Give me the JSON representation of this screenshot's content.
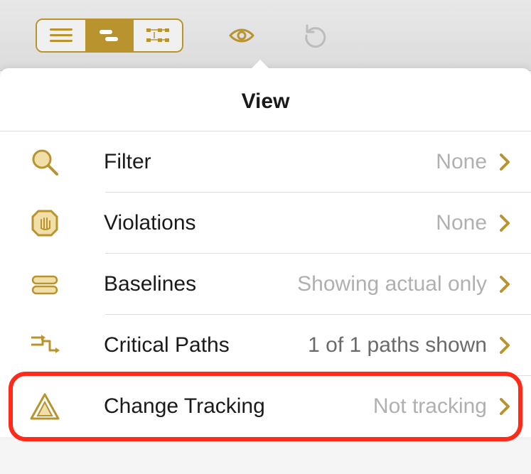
{
  "toolbar": {
    "segments": [
      "list-view",
      "gantt-view",
      "network-view"
    ],
    "active_segment": 1,
    "eye_label": "view-options",
    "undo_label": "undo"
  },
  "popover": {
    "title": "View",
    "items": [
      {
        "icon": "search-icon",
        "label": "Filter",
        "value": "None"
      },
      {
        "icon": "hand-stop-icon",
        "label": "Violations",
        "value": "None"
      },
      {
        "icon": "layers-icon",
        "label": "Baselines",
        "value": "Showing actual only"
      },
      {
        "icon": "critical-path-icon",
        "label": "Critical Paths",
        "value": "1 of 1 paths shown",
        "darker": true
      },
      {
        "icon": "triangle-icon",
        "label": "Change Tracking",
        "value": "Not tracking",
        "highlighted": true
      }
    ]
  },
  "colors": {
    "accent": "#b8932e",
    "accent_light": "#d8bb5f",
    "highlight": "#ff2a1a",
    "muted": "#b0b0b0"
  }
}
